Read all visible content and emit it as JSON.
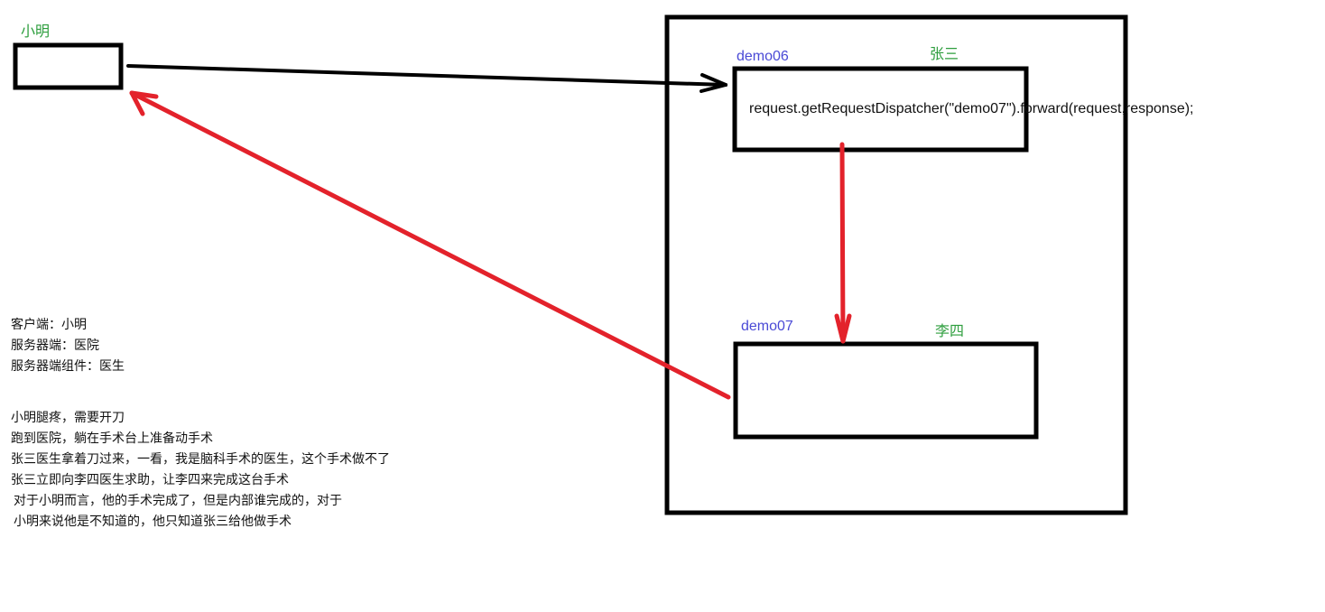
{
  "diagram": {
    "client": {
      "name": "小明"
    },
    "server_components": [
      {
        "id": "demo06",
        "person": "张三",
        "code": "request.getRequestDispatcher(\"demo07\").forward(request,response);"
      },
      {
        "id": "demo07",
        "person": "李四"
      }
    ],
    "colors": {
      "box_border": "#000000",
      "forward_arrow": "#e3222b",
      "request_arrow": "#000000",
      "label_green": "#2e9e3e",
      "label_blue": "#4a4ad6"
    }
  },
  "notes": {
    "definitions": [
      "客户端：小明",
      "服务器端：医院",
      "服务器端组件：医生"
    ],
    "story": [
      "小明腿疼，需要开刀",
      "跑到医院，躺在手术台上准备动手术",
      "张三医生拿着刀过来，一看，我是脑科手术的医生，这个手术做不了",
      "张三立即向李四医生求助，让李四来完成这台手术",
      "对于小明而言，他的手术完成了，但是内部谁完成的，对于",
      "小明来说他是不知道的，他只知道张三给他做手术"
    ]
  }
}
